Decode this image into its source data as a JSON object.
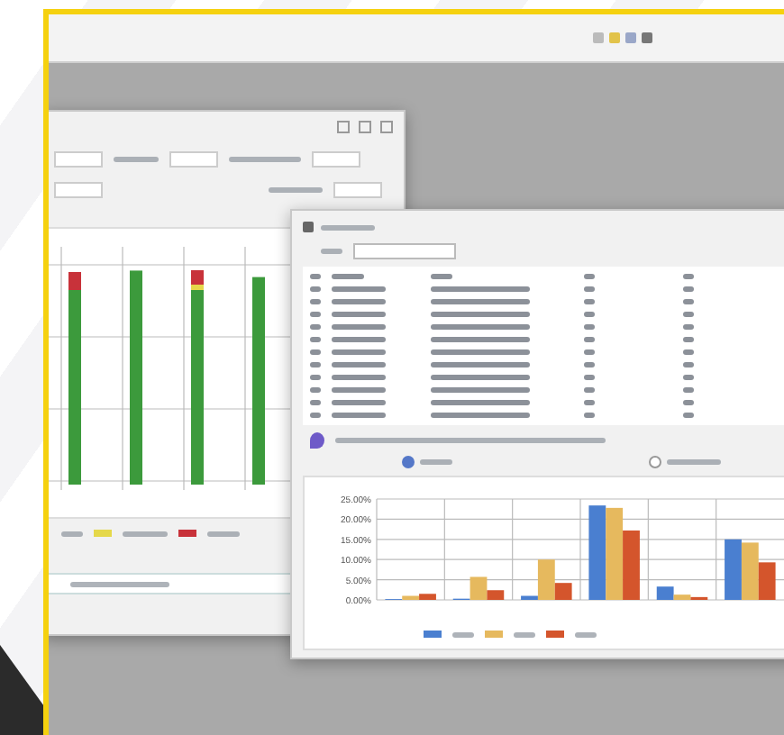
{
  "results_window": {
    "options": [
      {
        "selected": true
      },
      {
        "selected": false
      }
    ],
    "chart_data": {
      "type": "bar",
      "grid": true,
      "yticks": [
        {
          "value": 0,
          "label": "0.00%"
        },
        {
          "value": 5,
          "label": "5.00%"
        },
        {
          "value": 10,
          "label": "10.00%"
        },
        {
          "value": 15,
          "label": "15.00%"
        },
        {
          "value": 20,
          "label": "20.00%"
        },
        {
          "value": 25,
          "label": "25.00%"
        }
      ],
      "ylim": [
        0,
        25
      ],
      "series": [
        {
          "color": "#4a7fd0",
          "values": [
            0.2,
            0.3,
            1,
            23.4,
            3.3,
            15
          ]
        },
        {
          "color": "#e6b95e",
          "values": [
            1,
            5.7,
            10,
            22.8,
            1.3,
            14.2
          ]
        },
        {
          "color": "#d4552c",
          "values": [
            1.5,
            2.4,
            4.2,
            17.2,
            0.7,
            9.3
          ]
        }
      ]
    }
  }
}
